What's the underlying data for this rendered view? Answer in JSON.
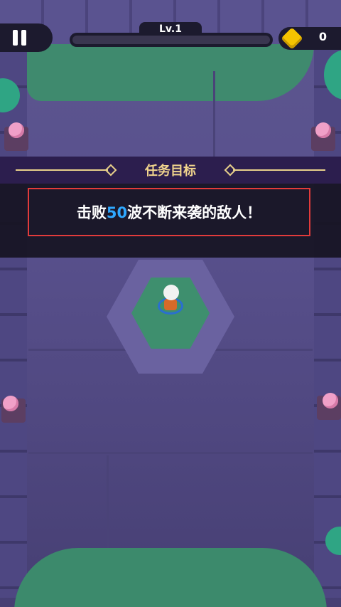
{
  "hud": {
    "level_label": "Lv.1",
    "xp_progress": 0.0,
    "coins": "0",
    "pause_icon": "pause-icon",
    "coin_icon": "gold-coin-icon"
  },
  "mission": {
    "title": "任务目标",
    "text_before": "击败",
    "wave_count": "50",
    "text_after": "波不断来袭的敌人！"
  },
  "colors": {
    "accent_gold": "#f1d58d",
    "highlight_blue": "#2fa8ff",
    "box_red": "#e23b3b",
    "coin_yellow": "#f5c400"
  }
}
